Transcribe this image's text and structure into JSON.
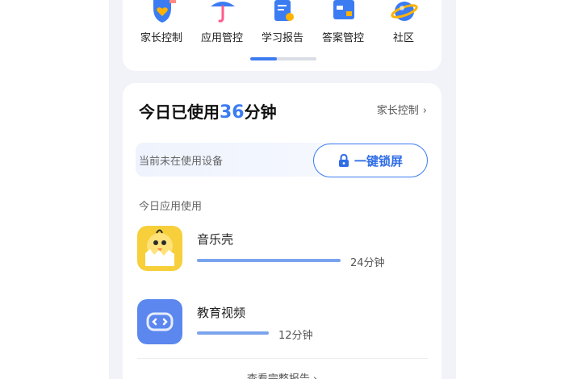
{
  "features": [
    {
      "icon": "heart-shield-icon",
      "label": "家长控制"
    },
    {
      "icon": "umbrella-icon",
      "label": "应用管控"
    },
    {
      "icon": "report-document-icon",
      "label": "学习报告"
    },
    {
      "icon": "answer-control-icon",
      "label": "答案管控"
    },
    {
      "icon": "community-globe-icon",
      "label": "社区"
    }
  ],
  "usage": {
    "prefix": "今日已使用",
    "minutes": "36",
    "suffix": "分钟",
    "parental_link": "家长控制",
    "chevron": "›"
  },
  "device_status": "当前未在使用设备",
  "lock_button": "一键锁屏",
  "section_label": "今日应用使用",
  "apps": [
    {
      "name": "音乐壳",
      "duration": "24分钟",
      "minutes": 24,
      "icon": "chick-icon",
      "icon_bg": "#f6cf3a"
    },
    {
      "name": "教育视频",
      "duration": "12分钟",
      "minutes": 12,
      "icon": "robot-face-icon",
      "icon_bg": "#5b87ee"
    }
  ],
  "full_report": "查看完整报告 ›",
  "colors": {
    "accent": "#3b7cf3",
    "bar": "#7aa3ee",
    "page_bg": "#f1f3f8"
  }
}
